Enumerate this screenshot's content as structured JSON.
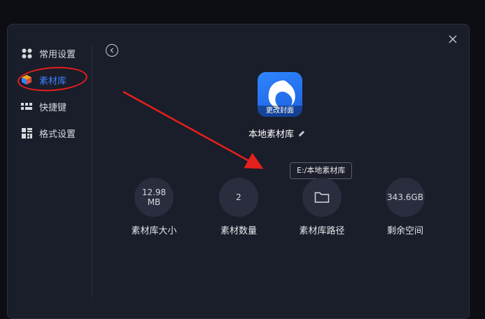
{
  "sidebar": {
    "items": [
      {
        "label": "常用设置",
        "icon": "grid-icon"
      },
      {
        "label": "素材库",
        "icon": "cube-icon",
        "active": true
      },
      {
        "label": "快捷键",
        "icon": "keyboard-icon"
      },
      {
        "label": "格式设置",
        "icon": "format-icon"
      }
    ]
  },
  "library": {
    "cover_label": "更改封面",
    "name": "本地素材库",
    "path_tooltip": "E:/本地素材库"
  },
  "stats": [
    {
      "value": "12.98 MB",
      "label": "素材库大小"
    },
    {
      "value": "2",
      "label": "素材数量"
    },
    {
      "value": "",
      "label": "素材库路径",
      "icon": "folder-icon"
    },
    {
      "value": "343.6GB",
      "label": "剩余空间"
    }
  ],
  "colors": {
    "accent": "#3d82ff",
    "annotation": "#e5201c"
  }
}
